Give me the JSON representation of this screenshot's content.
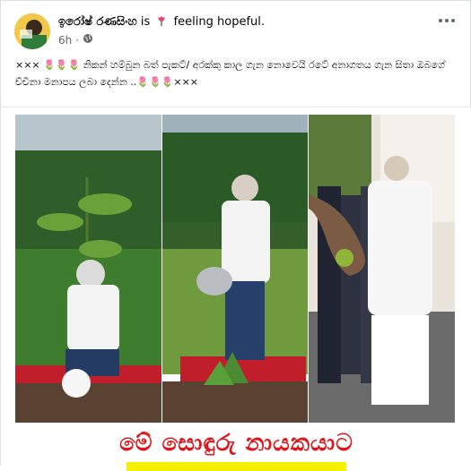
{
  "post": {
    "author": "ඉරෝෂ් රණසිංහ",
    "is": "is",
    "feeling": "feeling hopeful.",
    "time": "6h",
    "audience_icon": "globe-icon",
    "text": "××× 🌷🌷🌷 නිකන් හම්බුන බත් පැකට්/ අරක්කු කාල ගැන නොවෙයි රටේ අනාගතය ගැන සිතා ඔබගේ ච්චිනා මනාපය ලබා දෙන්න ..🌷🌷🌷×××"
  },
  "image": {
    "banner": "මේ සොඳුරු නායකයාට"
  },
  "colors": {
    "banner_red": "#e0161a",
    "banner_yellow": "#f5f000",
    "meta_gray": "#65676b"
  }
}
